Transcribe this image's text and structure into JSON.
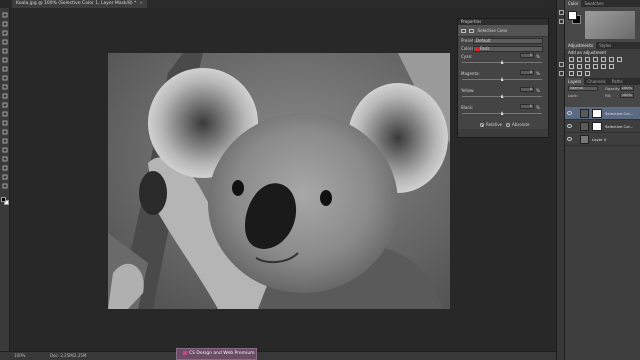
{
  "document": {
    "tab_label": "Koala.jpg @ 100% (Selective Color 1, Layer Mask/8) *"
  },
  "toolbar": {
    "tools": [
      "move-tool",
      "marquee-tool",
      "lasso-tool",
      "quick-select-tool",
      "crop-tool",
      "eyedropper-tool",
      "healing-tool",
      "brush-tool",
      "clone-stamp-tool",
      "history-brush-tool",
      "eraser-tool",
      "gradient-tool",
      "blur-tool",
      "dodge-tool",
      "pen-tool",
      "type-tool",
      "path-select-tool",
      "shape-tool",
      "hand-tool",
      "zoom-tool"
    ]
  },
  "status": {
    "zoom": "100%",
    "doc_info": "Doc: 2.25M/2.25M"
  },
  "taskbar": {
    "app_label": "CS Design and Web Premium"
  },
  "properties": {
    "title": "Properties",
    "header": "Selective Color",
    "preset_label": "Preset:",
    "preset_value": "Default",
    "colors_label": "Colors:",
    "colors_value": "Reds",
    "sliders": [
      {
        "label": "Cyan:",
        "value": "0",
        "unit": "%"
      },
      {
        "label": "Magenta:",
        "value": "0",
        "unit": "%"
      },
      {
        "label": "Yellow:",
        "value": "0",
        "unit": "%"
      },
      {
        "label": "Black:",
        "value": "0",
        "unit": "%"
      }
    ],
    "method": {
      "relative": "Relative",
      "absolute": "Absolute",
      "selected": "Relative"
    }
  },
  "dock": {
    "color_tabs": [
      "Color",
      "Swatches"
    ],
    "adjust_tabs": [
      "Adjustments",
      "Styles"
    ],
    "adjust_title": "Add an adjustment",
    "layers_tabs": [
      "Layers",
      "Channels",
      "Paths"
    ],
    "blend_mode": "Normal",
    "opacity_label": "Opacity:",
    "opacity_value": "100%",
    "lock_label": "Lock:",
    "fill_label": "Fill:",
    "fill_value": "100%",
    "layers": [
      {
        "name": "Selective Col...",
        "selected": true,
        "has_mask": true
      },
      {
        "name": "Selective Col...",
        "selected": false,
        "has_mask": true
      },
      {
        "name": "Layer 0",
        "selected": false,
        "has_mask": false
      }
    ]
  }
}
